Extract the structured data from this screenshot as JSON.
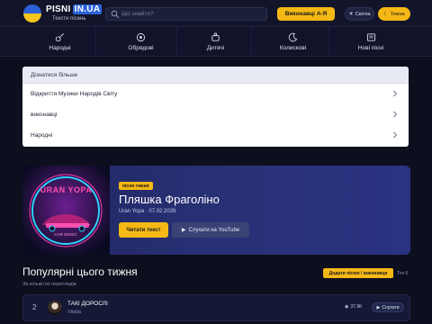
{
  "header": {
    "logo_main": "PISNI",
    "logo_domain": "IN.UA",
    "logo_tagline": "Тексти пісень",
    "search_placeholder": "Що знайти?",
    "artists_label": "Виконавці  А-Я",
    "light_label": "Світла",
    "dark_label": "Темна"
  },
  "categories": [
    {
      "label": "Народні",
      "icon": "guitar-icon"
    },
    {
      "label": "Обрядові",
      "icon": "wreath-icon"
    },
    {
      "label": "Дитячі",
      "icon": "toy-icon"
    },
    {
      "label": "Колискові",
      "icon": "moon-icon"
    },
    {
      "label": "Нові пісні",
      "icon": "newspaper-icon"
    }
  ],
  "dropdown": {
    "heading": "Дізнатися більше",
    "items": [
      {
        "label": "Відкриття Музики Народів Світу"
      },
      {
        "label": "виконавці"
      },
      {
        "label": "Народні"
      }
    ]
  },
  "feature": {
    "badge": "пісня тижня",
    "title": "Пляшка Фраголіно",
    "meta": "Uran Yopa · 07.02.2026",
    "read_label": "Читати текст",
    "youtube_label": "Слухати на YouTube",
    "cover_text": "URAN YOPA"
  },
  "popular": {
    "title": "Популярні цього тижня",
    "subtitle": "За кількістю переглядів",
    "add_label": "Додати пісню / виконавця",
    "top_label": "Топ 6",
    "rows": [
      {
        "rank": "2",
        "song": "ТАКІ ДОРОСЛІ",
        "artist": "Vitalia",
        "views": "37.9K",
        "listen": "Слухати"
      }
    ]
  },
  "colors": {
    "accent": "#f5b815",
    "background": "#0d0f1e",
    "card": "#283074"
  }
}
